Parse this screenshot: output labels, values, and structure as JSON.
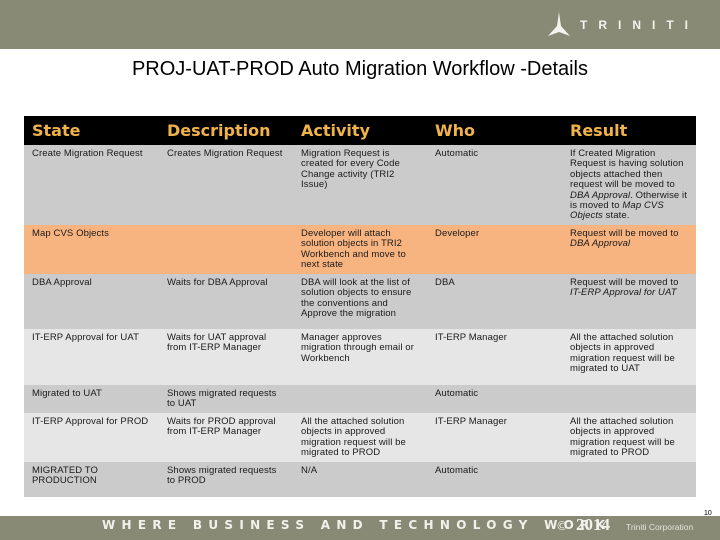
{
  "header": {
    "logo_text": "TRINITI",
    "logo_icon": "triniti-peak-icon",
    "title": "PROJ-UAT-PROD Auto Migration Workflow -Details"
  },
  "table": {
    "columns": [
      "State",
      "Description",
      "Activity",
      "Who",
      "Result"
    ],
    "rows": [
      {
        "style": "g",
        "state": "Create Migration Request",
        "description": "Creates Migration Request",
        "activity": "Migration Request is created for every Code Change activity (TRI2 Issue)",
        "who": "Automatic",
        "result_parts": [
          {
            "text": "If Created Migration Request is having solution objects attached then request will be moved to ",
            "italic": false
          },
          {
            "text": "DBA Approval",
            "italic": true
          },
          {
            "text": ". Otherwise it is moved to ",
            "italic": false
          },
          {
            "text": "Map CVS Objects",
            "italic": true
          },
          {
            "text": " state.",
            "italic": false
          }
        ]
      },
      {
        "style": "o",
        "state": "Map CVS Objects",
        "description": "",
        "activity": "Developer will attach solution objects in TRI2 Workbench and move to next state",
        "who": "Developer",
        "result_parts": [
          {
            "text": "Request will be moved to ",
            "italic": false
          },
          {
            "text": "DBA Approval",
            "italic": true
          }
        ]
      },
      {
        "style": "g",
        "state": "DBA Approval",
        "description": "Waits for DBA Approval",
        "activity": "DBA will look at the list of solution objects to ensure the conventions and Approve the migration",
        "who": "DBA",
        "result_parts": [
          {
            "text": "Request will be moved to ",
            "italic": false
          },
          {
            "text": "IT-ERP Approval for UAT",
            "italic": true
          }
        ]
      },
      {
        "style": "l",
        "state": "IT-ERP Approval for UAT",
        "description": "Waits for UAT approval from IT-ERP Manager",
        "activity": "Manager approves migration through email or Workbench",
        "who": "IT-ERP Manager",
        "result_parts": [
          {
            "text": "All the attached solution objects in approved migration request will be migrated to UAT",
            "italic": false
          }
        ]
      },
      {
        "style": "g",
        "state": "Migrated to UAT",
        "description": "Shows migrated requests to UAT",
        "activity": "",
        "who": "Automatic",
        "result_parts": []
      },
      {
        "style": "l",
        "state": "IT-ERP Approval for PROD",
        "description": "Waits for PROD approval from IT-ERP Manager",
        "activity": "All the attached solution objects in approved migration request will be migrated to PROD",
        "who": "IT-ERP Manager",
        "result_parts": [
          {
            "text": "All the attached solution objects in approved migration request will be migrated to PROD",
            "italic": false
          }
        ]
      },
      {
        "style": "g",
        "state": "MIGRATED TO PRODUCTION",
        "description": "Shows migrated requests to PROD",
        "activity": "N/A",
        "who": "Automatic",
        "result_parts": []
      }
    ]
  },
  "footer": {
    "slogan": "WHERE BUSINESS AND TECHNOLOGY WORK",
    "copyright_symbol": "©",
    "year": "2014",
    "company": "Triniti Corporation",
    "page_number": "10"
  },
  "colors": {
    "band": "#888a76",
    "header_bg": "#000000",
    "header_text": "#f0b34a",
    "row_gray": "#cbcbcb",
    "row_orange": "#f8b480",
    "row_light": "#e6e6e6"
  }
}
